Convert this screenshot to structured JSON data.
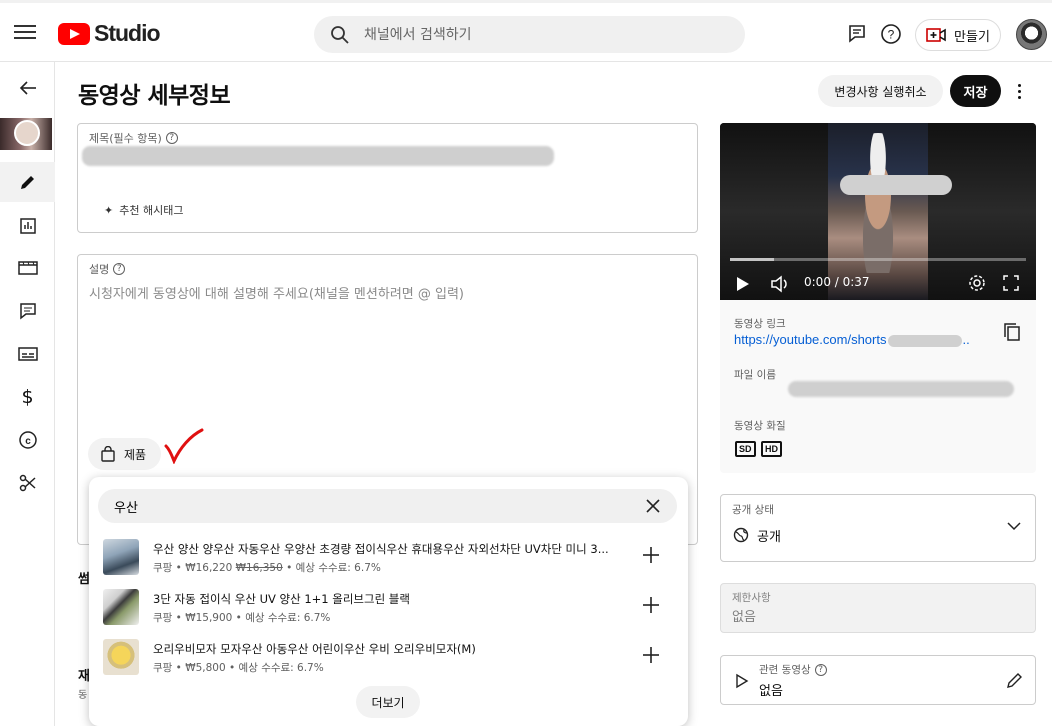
{
  "header": {
    "logo_text": "Studio",
    "search_placeholder": "채널에서 검색하기",
    "create_label": "만들기"
  },
  "page": {
    "title": "동영상 세부정보",
    "undo_label": "변경사항 실행취소",
    "save_label": "저장"
  },
  "title_field": {
    "label": "제목(필수 항목)",
    "hashtag_label": "추천 해시태그"
  },
  "description_field": {
    "label": "설명",
    "placeholder": "시청자에게 동영상에 대해 설명해 주세요(채널을 멘션하려면 @ 입력)",
    "product_chip_label": "제품"
  },
  "product_search": {
    "query": "우산",
    "products": [
      {
        "title": "우산 양산 양우산 자동우산 우양산 초경량 접이식우산 휴대용우산 자외선차단 UV차단 미니 3...",
        "seller": "쿠팡",
        "price": "₩16,220",
        "original_price": "₩16,350",
        "commission": "• 예상 수수료: 6.7%"
      },
      {
        "title": "3단 자동 접이식 우산 UV 양산 1+1 올리브그린 블랙",
        "seller": "쿠팡",
        "price": "₩15,900",
        "original_price": "",
        "commission": "• 예상 수수료: 6.7%"
      },
      {
        "title": "오리우비모자 모자우산 아동우산 어린이우산 우비 오리우비모자(M)",
        "seller": "쿠팡",
        "price": "₩5,800",
        "original_price": "",
        "commission": "• 예상 수수료: 6.7%"
      }
    ],
    "more_label": "더보기"
  },
  "video_panel": {
    "time": "0:00 / 0:37",
    "link_label": "동영상 링크",
    "link_text": "https://youtube.com/shorts",
    "link_suffix": "..",
    "filename_label": "파일 이름",
    "quality_label": "동영상 화질",
    "quality_badges": [
      "SD",
      "HD"
    ]
  },
  "visibility": {
    "label": "공개 상태",
    "value": "공개"
  },
  "restrictions": {
    "label": "제한사항",
    "value": "없음"
  },
  "related_video": {
    "label": "관련 동영상",
    "value": "없음"
  },
  "left_peek": {
    "text_1": "썸",
    "text_2": "재",
    "text_3": "동"
  },
  "colors": {
    "accent": "#ff0000",
    "link": "#065fd4",
    "checkmark": "#e01010"
  }
}
